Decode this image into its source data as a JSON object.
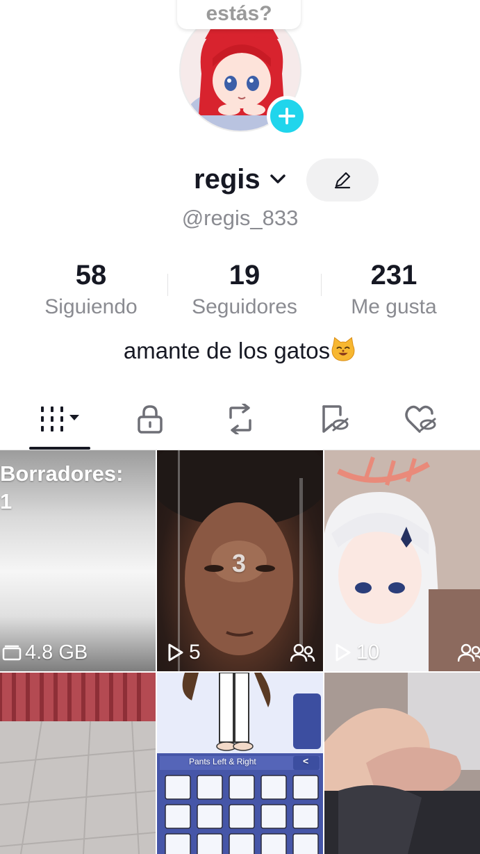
{
  "profile": {
    "bubble_text": "estás?",
    "username": "regis",
    "handle": "@regis_833",
    "bio": "amante de los gatos",
    "bio_emoji": "cat-face-emoji"
  },
  "stats": [
    {
      "value": "58",
      "label": "Siguiendo"
    },
    {
      "value": "19",
      "label": "Seguidores"
    },
    {
      "value": "231",
      "label": "Me gusta"
    }
  ],
  "tabs": [
    {
      "icon": "grid-icon",
      "selected": true
    },
    {
      "icon": "lock-icon",
      "selected": false
    },
    {
      "icon": "repost-icon",
      "selected": false
    },
    {
      "icon": "bookmark-hidden-icon",
      "selected": false
    },
    {
      "icon": "heart-hidden-icon",
      "selected": false
    }
  ],
  "grid": {
    "drafts": {
      "title": "Borradores:",
      "count": "1",
      "size": "4.8 GB"
    },
    "videos": [
      {
        "views": "5",
        "overlay": "3"
      },
      {
        "views": "10"
      },
      {},
      {
        "panel_title": "Pants Left & Right",
        "back": "<"
      },
      {}
    ]
  },
  "colors": {
    "accent_blue": "#20d5ec",
    "text_primary": "#161823",
    "text_secondary": "#8a8b91"
  }
}
